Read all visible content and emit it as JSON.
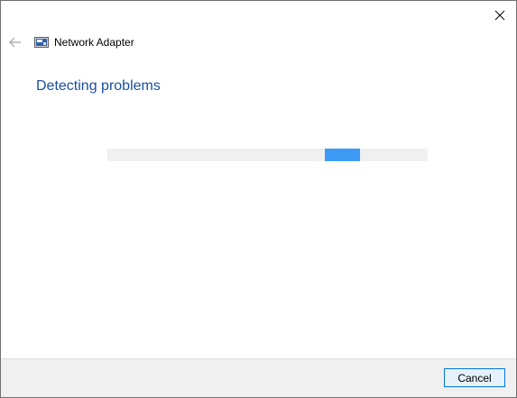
{
  "window": {
    "title": "Network Adapter"
  },
  "icons": {
    "close": "close-icon",
    "back": "back-arrow-icon",
    "app": "network-adapter-icon"
  },
  "main": {
    "heading": "Detecting problems",
    "progress": {
      "indeterminate": true,
      "chunk_start_fraction": 0.679,
      "chunk_width_fraction": 0.11
    }
  },
  "footer": {
    "cancel_label": "Cancel"
  },
  "colors": {
    "heading": "#1a4ea0",
    "progress_track": "#f0f0f0",
    "progress_chunk": "#3d9bf5",
    "footer_bg": "#f0f0f0",
    "button_border": "#0078d7"
  }
}
